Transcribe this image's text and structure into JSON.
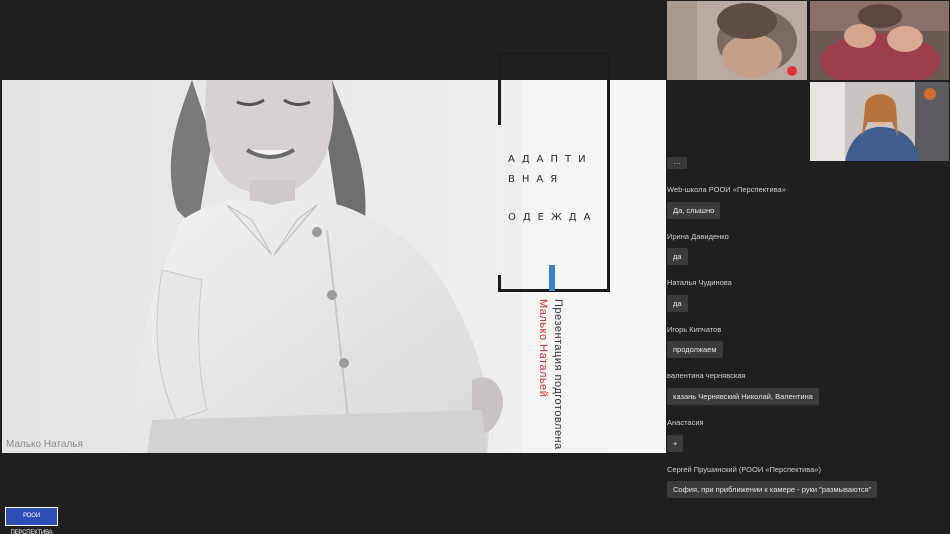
{
  "presentation": {
    "title_line1": "АДАПТИ",
    "title_line2": "ВНАЯ",
    "title_line3": "ОДЕЖДА",
    "credit_line1": "Презентация подготовлена",
    "credit_line2": "Малько Натальей",
    "accent_blue": "#3a7fd0",
    "accent_red": "#cf2d2d"
  },
  "screen_share": {
    "presenter_name": "Малько Наталья"
  },
  "chat": {
    "more_label": "...",
    "messages": [
      {
        "author": "Web-школа РООИ «Перспектива»",
        "text": "Да, слышно"
      },
      {
        "author": "Ирина Давиденко",
        "text": "да"
      },
      {
        "author": "Наталья Чудинова",
        "text": "да"
      },
      {
        "author": "Игорь Кипчатов",
        "text": "продолжаем"
      },
      {
        "author": "валентина чернявская",
        "text": "казань Чернявский Николай, Валентина"
      },
      {
        "author": "Анастасия",
        "text": "+"
      },
      {
        "author": "Сергей Прушинский (РООИ «Перспектива»)",
        "text": "София, при приближении к камере - руки \"размываются\""
      }
    ]
  },
  "logo": {
    "text": "РООИ ПЕРСПЕКТИВА"
  }
}
